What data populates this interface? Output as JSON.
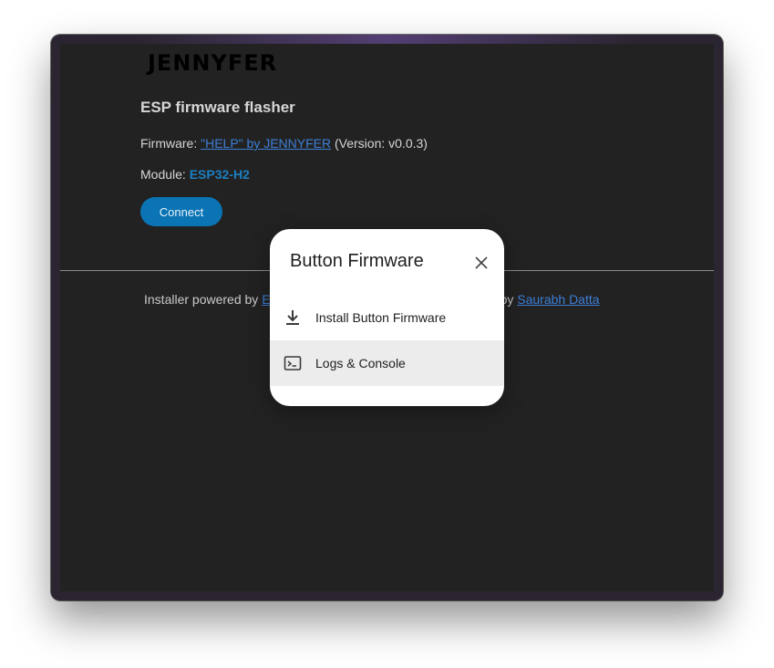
{
  "app": {
    "logo_text": "JENNYFER",
    "heading": "ESP firmware flasher",
    "firmware_label": "Firmware:",
    "firmware_link": "\"HELP\" by JENNYFER",
    "firmware_version": "(Version: v0.0.3)",
    "module_label": "Module:",
    "module_value": "ESP32-H2",
    "connect_label": "Connect"
  },
  "footer": {
    "left_text": "Installer powered by",
    "left_link": "E",
    "right_text": "ect by",
    "right_link": "Saurabh Datta"
  },
  "dialog": {
    "title": "Button Firmware",
    "items": [
      {
        "label": "Install Button Firmware",
        "icon": "download-icon"
      },
      {
        "label": "Logs & Console",
        "icon": "terminal-icon"
      }
    ]
  },
  "colors": {
    "page_bg": "#222222",
    "accent": "#0b74b5",
    "link": "#3d7fd6",
    "dialog_bg": "#ffffff",
    "dialog_item_highlight": "#ececec"
  }
}
